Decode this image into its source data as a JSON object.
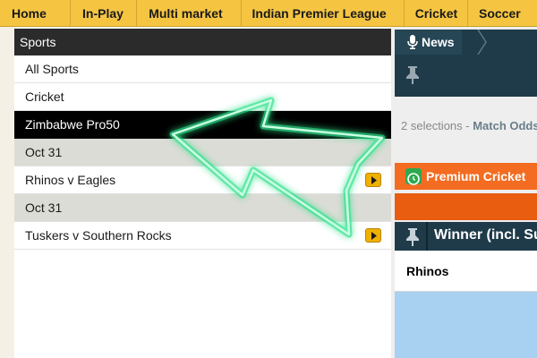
{
  "topnav": {
    "items": [
      "Home",
      "In-Play",
      "Multi market",
      "Indian Premier League",
      "Cricket",
      "Soccer"
    ]
  },
  "sidebar": {
    "header": "Sports",
    "rows": [
      {
        "label": "All Sports",
        "type": "link"
      },
      {
        "label": "Cricket",
        "type": "link"
      },
      {
        "label": "Zimbabwe Pro50",
        "type": "active"
      },
      {
        "label": "Oct 31",
        "type": "date"
      },
      {
        "label": "Rhinos v Eagles",
        "type": "event"
      },
      {
        "label": "Oct 31",
        "type": "date"
      },
      {
        "label": "Tuskers v Southern Rocks",
        "type": "event"
      }
    ]
  },
  "right": {
    "news_label": "News",
    "selections_text": "2 selections - ",
    "selections_match": "Match Odds",
    "premium_label": "Premium Cricket",
    "winner_label": "Winner (incl. Super Over)",
    "runner": "Rhinos"
  },
  "colors": {
    "nav_bg": "#f5c542",
    "dark_panel": "#1f3b4a",
    "orange": "#f36c21",
    "neon_green": "#3dff9c",
    "odds_blue": "#a8d0f0"
  }
}
